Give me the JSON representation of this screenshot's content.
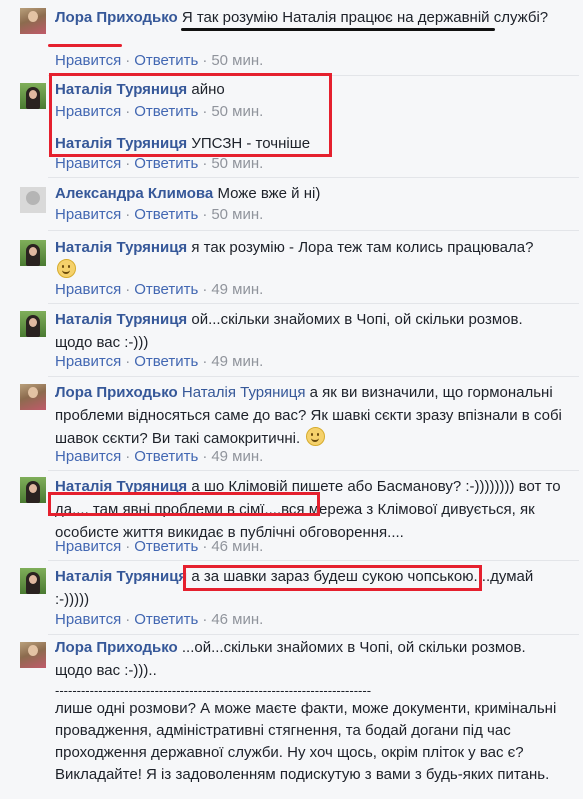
{
  "colors": {
    "author": "#365899",
    "link": "#4267b2",
    "meta": "#90949c",
    "highlight": "#e5202e"
  },
  "actions": {
    "like": "Нравится",
    "reply": "Ответить",
    "sep": "·"
  },
  "comments": [
    {
      "author": "Лора Приходько",
      "text": "Я так розумію Наталія працює на державній службі?",
      "time": "50 мин."
    },
    {
      "author": "Наталія Туряниця",
      "text": "айно",
      "time": "50 мин."
    },
    {
      "author": "Наталія Туряниця",
      "text": "УПСЗН - точніше",
      "time": "50 мин."
    },
    {
      "author": "Александра Климова",
      "text": "Може вже й ні)",
      "time": "50 мин."
    },
    {
      "author": "Наталія Туряниця",
      "text": "я так розумію - Лора теж там колись працювала?",
      "emoji": "smile-emoji-icon",
      "time": "49 мин."
    },
    {
      "author": "Наталія Туряниця",
      "text": "ой...скільки знайомих в Чопі, ой скільки розмов. щодо вас :-)))",
      "time": "49 мин."
    },
    {
      "author": "Лора Приходько",
      "mention": "Наталія Туряниця",
      "text": "а як ви визначили, що гормональні проблеми відносяться саме до вас? Як шавкі сєкти зразу впізнали в собі шавок сєкти? Ви такі самокритичні.",
      "emoji": "smile-emoji-icon",
      "time": "49 мин."
    },
    {
      "author": "Наталія Туряниця",
      "text": "а шо Клімовій пишете або Басманову? :-)))))))) вот то да.... там явні проблеми в сімї....вся мережа з Клімової дивується, як особисте життя викидає в публічні обговорення....",
      "time": "46 мин."
    },
    {
      "author": "Наталія Туряниця",
      "text": "а за шавки зараз будеш сукою чопською....думай :-)))))",
      "time": "46 мин."
    },
    {
      "author": "Лора Приходько",
      "text": "...ой...скільки знайомих в Чопі, ой скільки розмов. щодо вас :-)))..",
      "divider": "-------------------------------------------------------------------------",
      "text2": "лише одні розмови? А може маєте факти, може документи, кримінальні провадження, адміністративні стягнення, та бодай догани під час проходження державної служби. Ну хоч щось, окрім пліток у вас є? Викладайте! Я із задоволенням подискутую з вами з будь-яких питань."
    }
  ]
}
